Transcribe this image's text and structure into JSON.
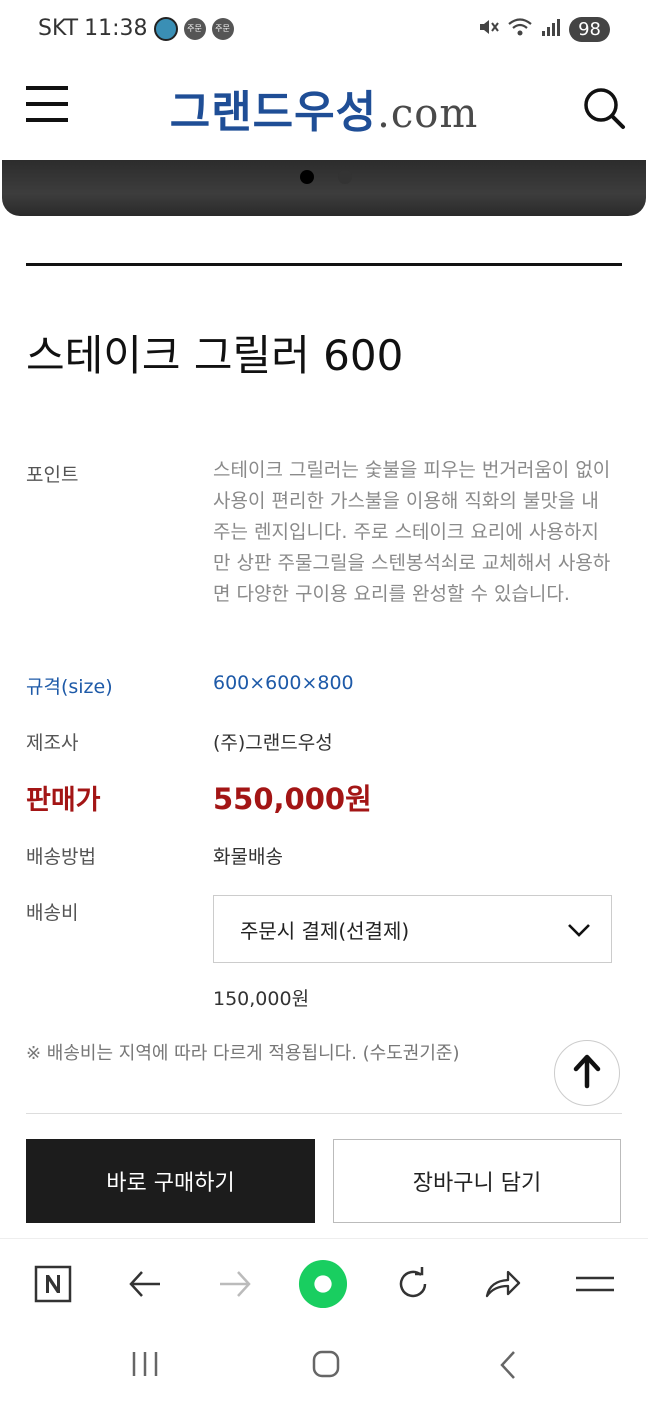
{
  "status_bar": {
    "carrier": "SKT",
    "time": "11:38",
    "badge_1": "주문",
    "badge_2": "주문",
    "battery": "98",
    "icons": [
      "mute-icon",
      "wifi-icon",
      "signal-icon"
    ]
  },
  "header": {
    "logo_main": "그랜드우성",
    "logo_suffix": ".com",
    "icons": [
      "menu-icon",
      "search-icon"
    ]
  },
  "banner": {
    "total_slides": 2,
    "active_slide": 1
  },
  "product": {
    "title": "스테이크 그릴러 600",
    "point_label": "포인트",
    "point_text": "스테이크 그릴러는 숯불을 피우는 번거러움이 없이 사용이 편리한 가스불을 이용해 직화의 불맛을 내주는 렌지입니다. 주로 스테이크 요리에 사용하지만 상판 주물그릴을 스텐봉석쇠로 교체해서 사용하면 다양한 구이용 요리를 완성할 수 있습니다.",
    "size_label": "규격(size)",
    "size_value": "600×600×800",
    "maker_label": "제조사",
    "maker_value": "(주)그랜드우성",
    "price_label": "판매가",
    "price_value": "550,000원",
    "shipping_method_label": "배송방법",
    "shipping_method_value": "화물배송",
    "shipping_fee_label": "배송비",
    "shipping_fee_select": "주문시 결제(선결제)",
    "shipping_fee_value": "150,000원",
    "shipping_note": "※ 배송비는 지역에 따라 다르게 적용됩니다. (수도권기준)"
  },
  "buttons": {
    "buy_now": "바로 구매하기",
    "add_to_cart": "장바구니 담기"
  },
  "browser_toolbar": {
    "icons": [
      "naver-n-icon",
      "back-arrow-icon",
      "forward-arrow-icon",
      "green-dot-icon",
      "refresh-icon",
      "share-icon",
      "menu-lines-icon"
    ]
  },
  "system_nav": {
    "icons": [
      "recent-apps-icon",
      "home-icon",
      "back-icon"
    ]
  },
  "colors": {
    "logo_blue": "#1f4e96",
    "price_red": "#a31515",
    "link_blue": "#1e5aa8",
    "buy_button_bg": "#1c1c1c",
    "naver_green": "#19ce60"
  }
}
